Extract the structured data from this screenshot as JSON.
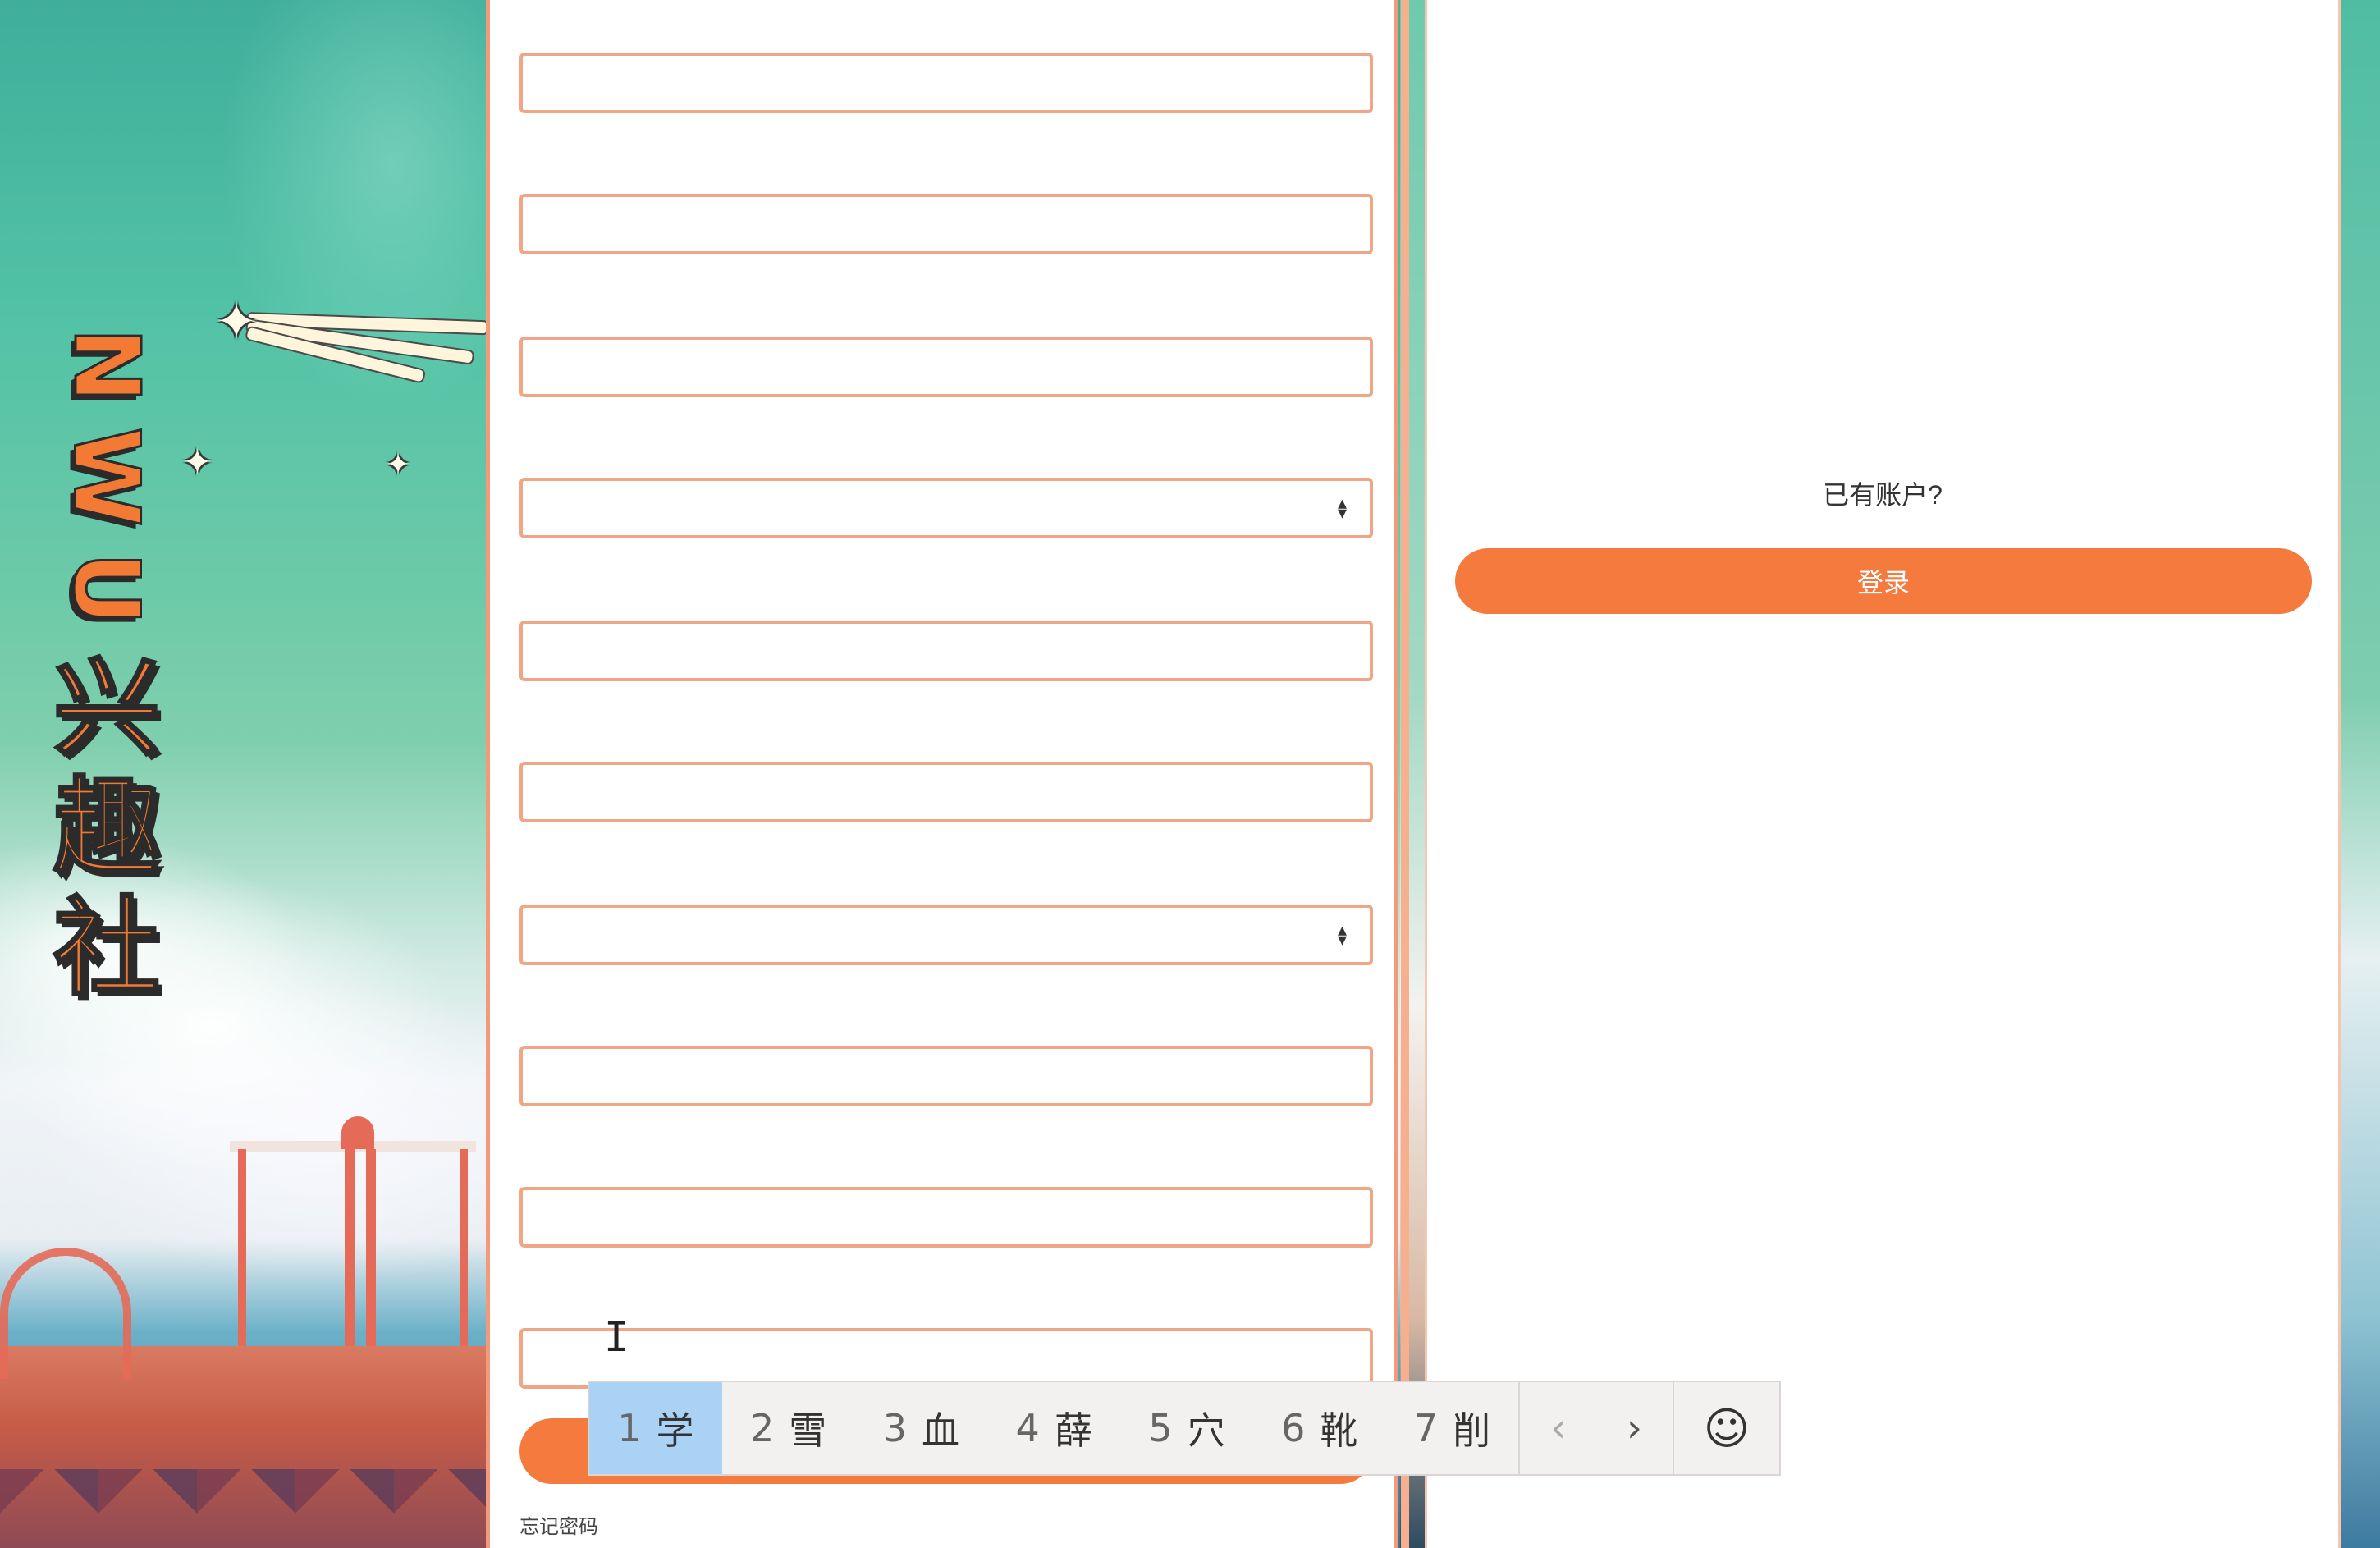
{
  "logo": {
    "chars": [
      "N",
      "W",
      "U",
      "兴",
      "趣",
      "社"
    ],
    "color": "#f27a35"
  },
  "form": {
    "fields": [
      {
        "kind": "text",
        "value": ""
      },
      {
        "kind": "text",
        "value": ""
      },
      {
        "kind": "text",
        "value": ""
      },
      {
        "kind": "select",
        "value": ""
      },
      {
        "kind": "text",
        "value": ""
      },
      {
        "kind": "text",
        "value": ""
      },
      {
        "kind": "select",
        "value": ""
      },
      {
        "kind": "text",
        "value": ""
      },
      {
        "kind": "text",
        "value": ""
      },
      {
        "kind": "text",
        "value": ""
      }
    ],
    "forgot_password": "忘记密码"
  },
  "login_panel": {
    "prompt": "已有账户?",
    "login_label": "登录"
  },
  "ime": {
    "candidates": [
      {
        "num": "1",
        "text": "学"
      },
      {
        "num": "2",
        "text": "雪"
      },
      {
        "num": "3",
        "text": "血"
      },
      {
        "num": "4",
        "text": "薛"
      },
      {
        "num": "5",
        "text": "穴"
      },
      {
        "num": "6",
        "text": "靴"
      },
      {
        "num": "7",
        "text": "削"
      }
    ],
    "prev_icon": "chevron-left-icon",
    "next_icon": "chevron-right-icon",
    "emoji_icon": "smiley-icon"
  },
  "colors": {
    "accent": "#f57a3e",
    "field_border": "#f0a586",
    "ime_selected": "#a9d2f5"
  }
}
